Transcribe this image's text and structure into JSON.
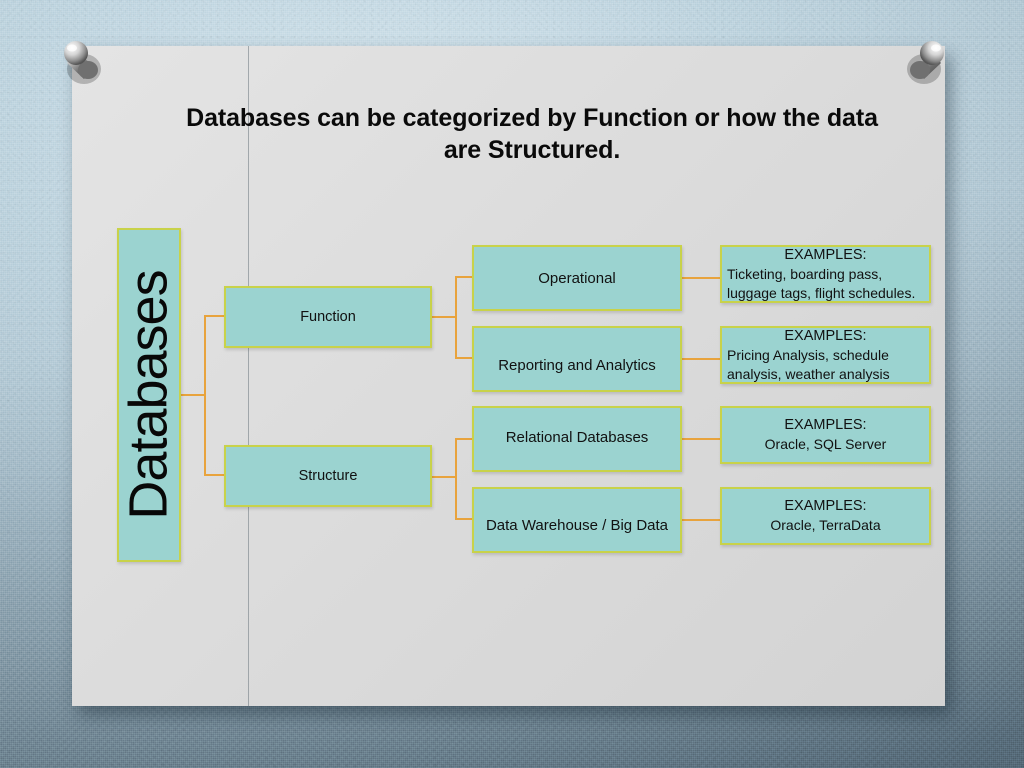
{
  "slide": {
    "title": "Databases can be categorized by Function or how the data are Structured.",
    "root": {
      "label": "Databases"
    },
    "categories": [
      {
        "label": "Function"
      },
      {
        "label": "Structure"
      }
    ],
    "types": [
      {
        "label": "Operational"
      },
      {
        "label": "Reporting and Analytics"
      },
      {
        "label": "Relational Databases"
      },
      {
        "label": "Data Warehouse /  Big Data"
      }
    ],
    "examples": [
      {
        "heading": "EXAMPLES:",
        "body": "Ticketing, boarding pass, luggage tags, flight schedules."
      },
      {
        "heading": "EXAMPLES:",
        "body": "Pricing Analysis, schedule analysis, weather analysis"
      },
      {
        "heading": "EXAMPLES:",
        "body": "Oracle, SQL Server"
      },
      {
        "heading": "EXAMPLES:",
        "body": "Oracle, TerraData"
      }
    ]
  },
  "decor": {
    "pin_left": "pushpin-icon",
    "pin_right": "pushpin-icon"
  },
  "colors": {
    "node_fill": "#9bd3d0",
    "node_border": "#c8d24a",
    "connector": "#e8a33d",
    "slide_bg": "#dcdcdc",
    "board_bg": "#b9ccd6",
    "text": "#111111"
  }
}
